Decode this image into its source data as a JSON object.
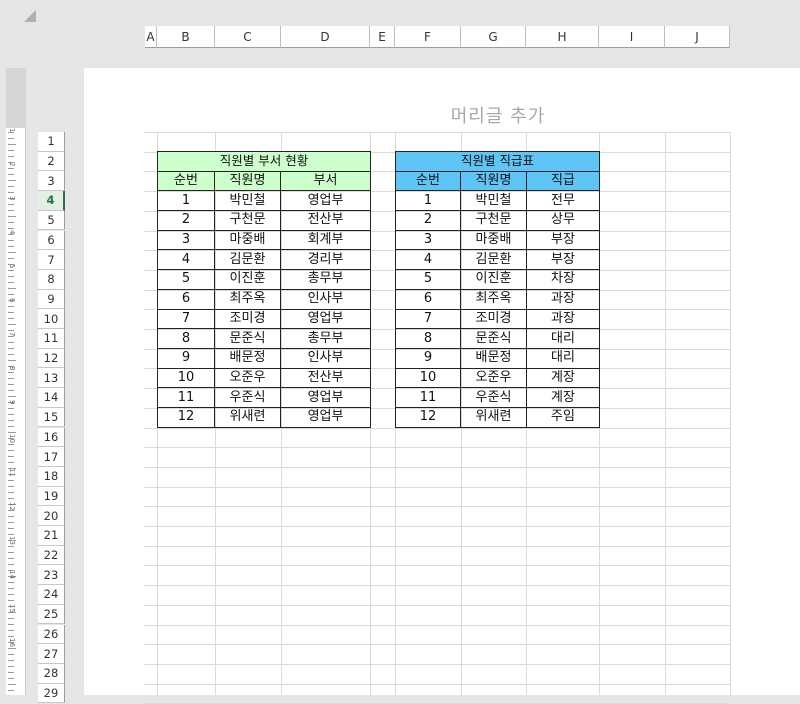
{
  "sheet": {
    "header_placeholder": "머리글 추가",
    "columns": [
      "A",
      "B",
      "C",
      "D",
      "E",
      "F",
      "G",
      "H",
      "I",
      "J"
    ],
    "rows": [
      "1",
      "2",
      "3",
      "4",
      "5",
      "6",
      "7",
      "8",
      "9",
      "10",
      "11",
      "12",
      "13",
      "14",
      "15",
      "16",
      "17",
      "18",
      "19",
      "20",
      "21",
      "22",
      "23",
      "24",
      "25",
      "26",
      "27",
      "28",
      "29"
    ],
    "active_row": "4",
    "ruler_labels": [
      "1",
      "1",
      "2",
      "3",
      "4",
      "5",
      "6",
      "7",
      "8",
      "9",
      "10",
      "11",
      "12",
      "13",
      "14",
      "15",
      "16"
    ]
  },
  "table_dept": {
    "title": "직원별 부서 현황",
    "headers": [
      "순번",
      "직원명",
      "부서"
    ],
    "rows": [
      [
        "1",
        "박민철",
        "영업부"
      ],
      [
        "2",
        "구천문",
        "전산부"
      ],
      [
        "3",
        "마중배",
        "회계부"
      ],
      [
        "4",
        "김문환",
        "경리부"
      ],
      [
        "5",
        "이진훈",
        "총무부"
      ],
      [
        "6",
        "최주옥",
        "인사부"
      ],
      [
        "7",
        "조미경",
        "영업부"
      ],
      [
        "8",
        "문준식",
        "총무부"
      ],
      [
        "9",
        "배문정",
        "인사부"
      ],
      [
        "10",
        "오준우",
        "전산부"
      ],
      [
        "11",
        "우준식",
        "영업부"
      ],
      [
        "12",
        "위새련",
        "영업부"
      ]
    ],
    "fill_color": "#ccffcc"
  },
  "table_rank": {
    "title": "직원별 직급표",
    "headers": [
      "순번",
      "직원명",
      "직급"
    ],
    "rows": [
      [
        "1",
        "박민철",
        "전무"
      ],
      [
        "2",
        "구천문",
        "상무"
      ],
      [
        "3",
        "마중배",
        "부장"
      ],
      [
        "4",
        "김문환",
        "부장"
      ],
      [
        "5",
        "이진훈",
        "차장"
      ],
      [
        "6",
        "최주옥",
        "과장"
      ],
      [
        "7",
        "조미경",
        "과장"
      ],
      [
        "8",
        "문준식",
        "대리"
      ],
      [
        "9",
        "배문정",
        "대리"
      ],
      [
        "10",
        "오준우",
        "계장"
      ],
      [
        "11",
        "우준식",
        "계장"
      ],
      [
        "12",
        "위새련",
        "주임"
      ]
    ],
    "fill_color": "#5fc4f6"
  }
}
